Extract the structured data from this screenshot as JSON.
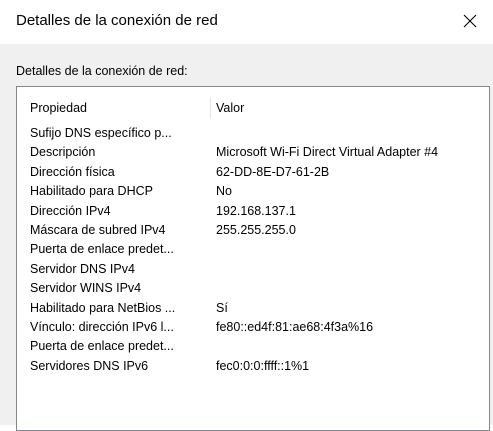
{
  "window": {
    "title": "Detalles de la conexión de red",
    "close_icon": "close-icon"
  },
  "group": {
    "label": "Detalles de la conexión de red:"
  },
  "table": {
    "headers": {
      "property": "Propiedad",
      "value": "Valor"
    },
    "rows": [
      {
        "property": "Sufijo DNS específico p...",
        "value": ""
      },
      {
        "property": "Descripción",
        "value": "Microsoft Wi-Fi Direct Virtual Adapter #4"
      },
      {
        "property": "Dirección física",
        "value": "62-DD-8E-D7-61-2B"
      },
      {
        "property": "Habilitado para DHCP",
        "value": "No"
      },
      {
        "property": "Dirección IPv4",
        "value": "192.168.137.1"
      },
      {
        "property": "Máscara de subred IPv4",
        "value": "255.255.255.0"
      },
      {
        "property": "Puerta de enlace predet...",
        "value": ""
      },
      {
        "property": "Servidor DNS IPv4",
        "value": ""
      },
      {
        "property": "Servidor WINS IPv4",
        "value": ""
      },
      {
        "property": "Habilitado para NetBios ...",
        "value": "Sí"
      },
      {
        "property": "Vínculo: dirección IPv6 l...",
        "value": "fe80::ed4f:81:ae68:4f3a%16"
      },
      {
        "property": "Puerta de enlace predet...",
        "value": ""
      },
      {
        "property": "Servidores DNS IPv6",
        "value": "fec0:0:0:ffff::1%1"
      }
    ]
  }
}
